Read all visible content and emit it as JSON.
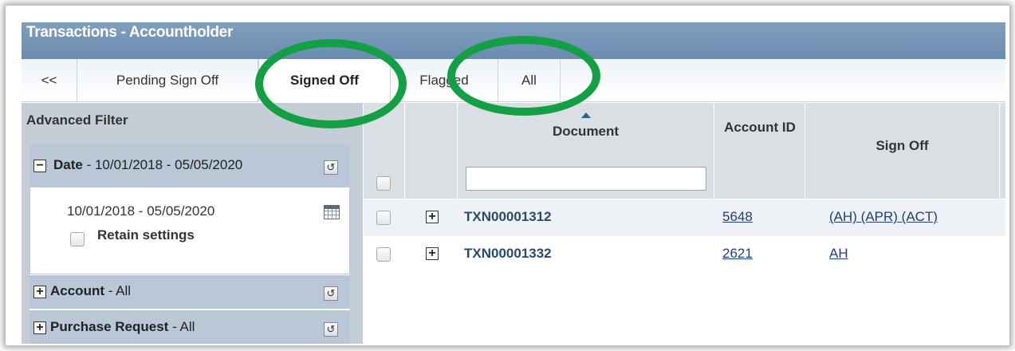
{
  "window": {
    "title": "Transactions - Accountholder"
  },
  "tabs": {
    "back": "<<",
    "pending": "Pending Sign Off",
    "signed_off": "Signed Off",
    "flagged": "Flagged",
    "all": "All",
    "active": "Signed Off"
  },
  "filter": {
    "header": "Advanced Filter",
    "date": {
      "name": "Date",
      "summary": " - 10/01/2018 - 05/05/2020",
      "range_value": "10/01/2018 - 05/05/2020",
      "retain_label": "Retain settings",
      "expander": "−"
    },
    "account": {
      "name": "Account",
      "summary": " - All",
      "expander": "+"
    },
    "purchase_request": {
      "name": "Purchase Request",
      "summary": " - All",
      "expander": "+"
    },
    "reset_glyph": "↺"
  },
  "grid": {
    "columns": {
      "document": "Document",
      "account_id": "Account ID",
      "sign_off": "Sign Off"
    },
    "document_filter_value": "",
    "rows": [
      {
        "document": "TXN00001312",
        "account_id": "5648",
        "sign_off": "(AH) (APR) (ACT)",
        "expander": "+"
      },
      {
        "document": "TXN00001332",
        "account_id": "2621",
        "sign_off": "AH",
        "expander": "+"
      }
    ]
  },
  "annotations": {
    "color": "#13a045",
    "circled": [
      "Signed Off",
      "All"
    ]
  },
  "colors": {
    "titlebar": "#6a8caf",
    "panel": "#c5ced7",
    "section": "#b9c7d6",
    "link": "#1f3f7a"
  }
}
